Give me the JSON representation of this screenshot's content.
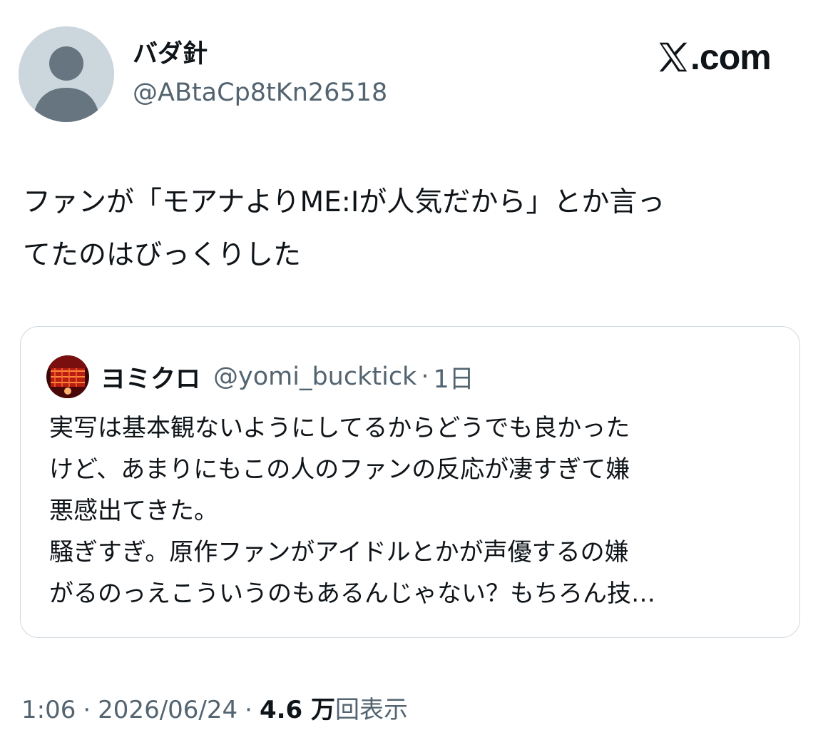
{
  "author": {
    "display_name": "バダ針",
    "handle": "@ABtaCp8tKn26518",
    "avatar_icon": "default-profile-icon"
  },
  "brand": {
    "text": ".com",
    "logo_icon": "x-logo-icon"
  },
  "tweet": {
    "text": "ファンが「モアナよりME:Iが人気だから」とか言っ\nてたのはびっくりした"
  },
  "quote": {
    "display_name": "ヨミクロ",
    "handle": "@yomi_bucktick",
    "separator": "·",
    "time": "1日",
    "text": "実写は基本観ないようにしてるからどうでも良かった\nけど、あまりにもこの人のファンの反応が凄すぎて嫌\n悪感出てきた。\n騒ぎすぎ。原作ファンがアイドルとかが声優するの嫌\nがるのっえこういうのもあるんじゃない？もちろん技…"
  },
  "meta": {
    "time": "1:06",
    "date": "2026/06/24",
    "separator": "·",
    "views_count": "4.6 万",
    "views_label": "回表示"
  },
  "colors": {
    "text_primary": "#0f1419",
    "text_secondary": "#536471",
    "border": "#cfd9de",
    "avatar_bg": "#ccd6dd"
  }
}
